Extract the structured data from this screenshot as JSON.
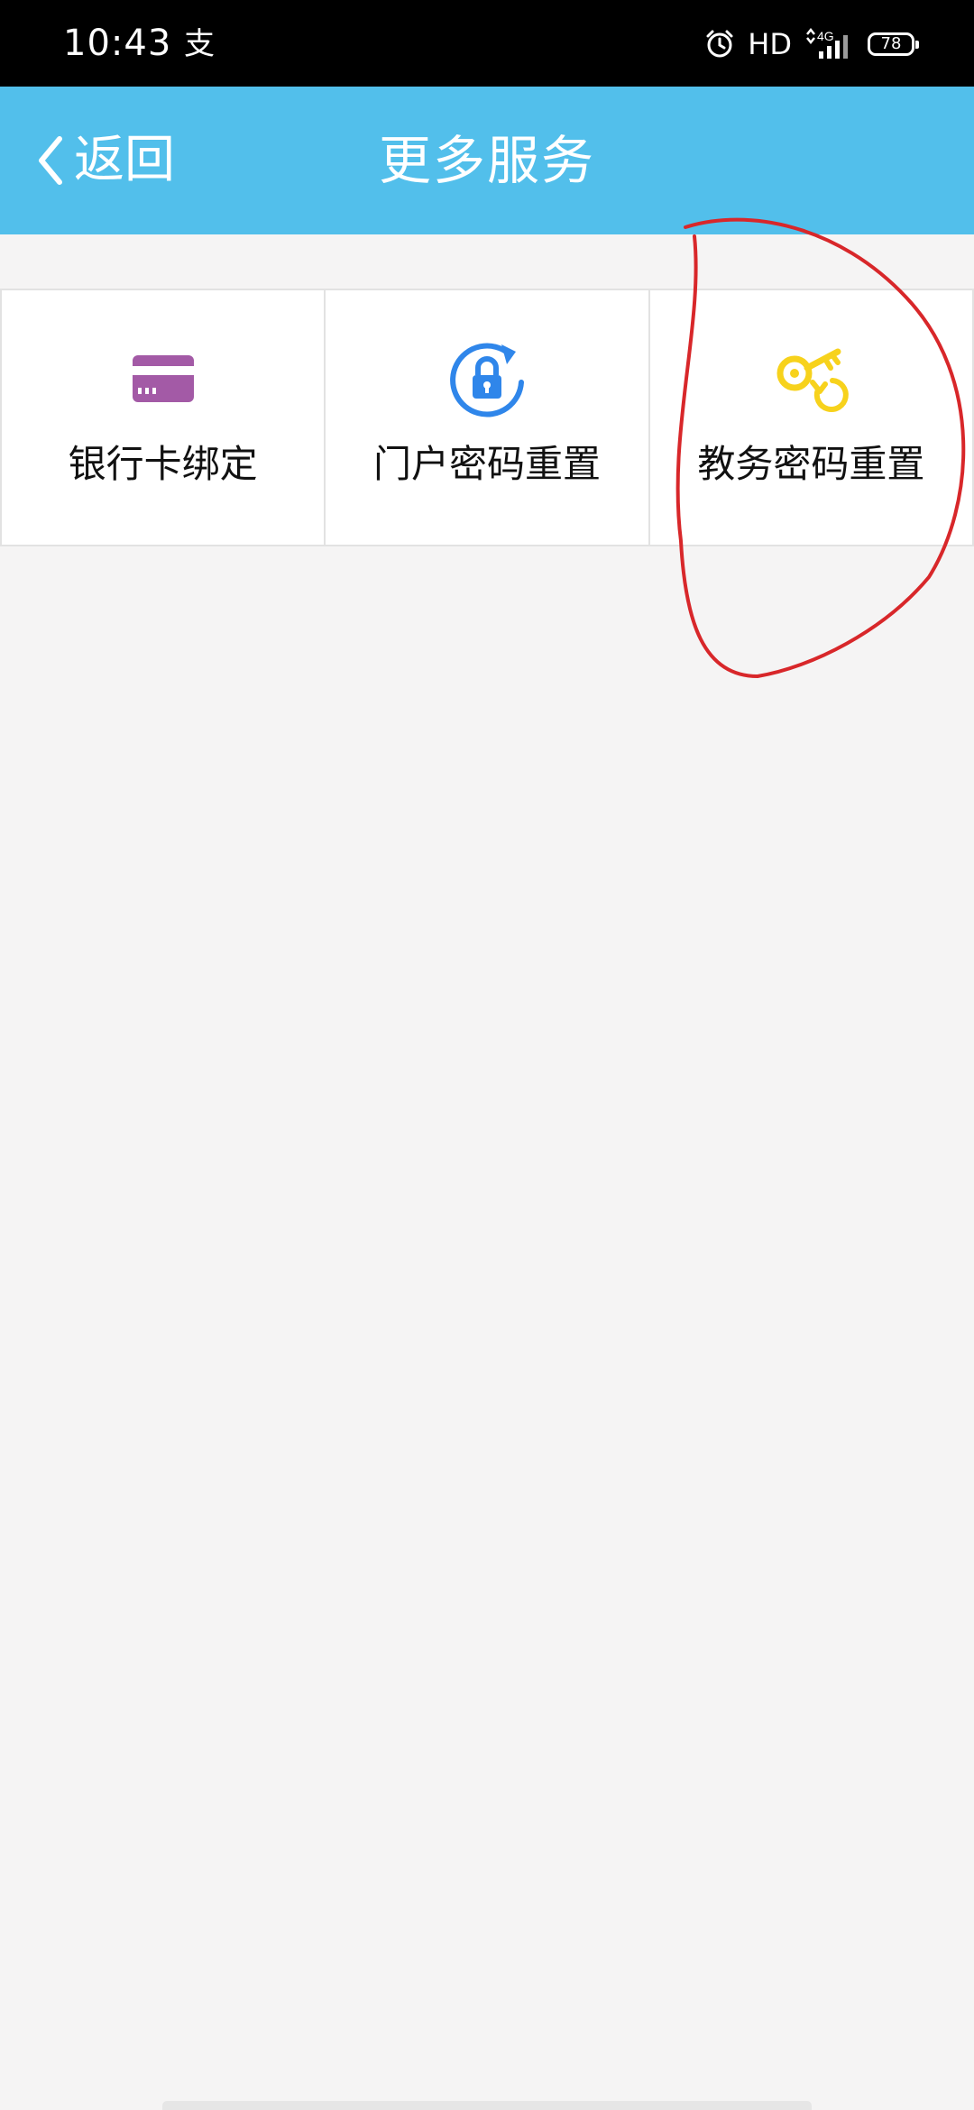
{
  "status_bar": {
    "time": "10:43",
    "app_indicator": "支",
    "alarm_icon": "alarm-clock-icon",
    "hd_label": "HD",
    "network_label": "4G",
    "signal_icon": "signal-bars-icon",
    "battery_level": "78",
    "background_color": "#000000"
  },
  "title_bar": {
    "back_label": "返回",
    "back_icon": "chevron-left-icon",
    "title": "更多服务",
    "background_color": "#52bfeb"
  },
  "services": [
    {
      "label": "银行卡绑定",
      "icon": "bank-card-icon",
      "color": "#a35aa6"
    },
    {
      "label": "门户密码重置",
      "icon": "lock-refresh-icon",
      "color": "#2f86ea"
    },
    {
      "label": "教务密码重置",
      "icon": "key-refresh-icon",
      "color": "#f7d21c"
    }
  ],
  "annotation": {
    "shape": "hand-drawn-circle",
    "target": "教务密码重置",
    "color": "#d8272a"
  }
}
